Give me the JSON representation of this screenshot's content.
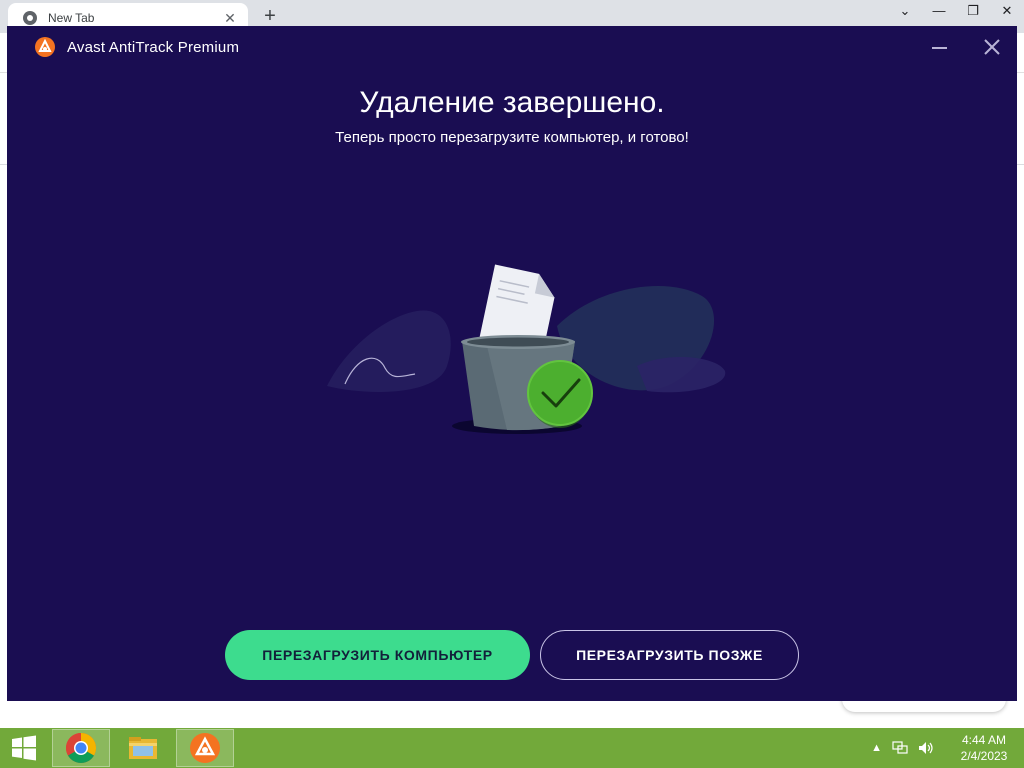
{
  "browser": {
    "tab_title": "New Tab",
    "tab_close": "✕",
    "new_tab": "+",
    "controls": [
      "⌄",
      "—",
      "❐",
      "✕"
    ]
  },
  "dialog": {
    "app_title": "Avast AntiTrack Premium",
    "heading": "Удаление завершено.",
    "subheading": "Теперь просто перезагрузите компьютер, и готово!",
    "restart_now_label": "ПЕРЕЗАГРУЗИТЬ КОМПЬЮТЕР",
    "restart_later_label": "ПЕРЕЗАГРУЗИТЬ ПОЗЖЕ",
    "colors": {
      "background": "#1a0d52",
      "primary_button": "#3ddc8e",
      "brand_orange": "#f47321",
      "check_green": "#4caf2f"
    }
  },
  "taskbar": {
    "apps": [
      {
        "name": "chrome-icon"
      },
      {
        "name": "file-explorer-icon"
      },
      {
        "name": "avast-icon"
      }
    ],
    "tray_arrow": "▲",
    "time": "4:44 AM",
    "date": "2/4/2023",
    "color": "#72a93a"
  }
}
